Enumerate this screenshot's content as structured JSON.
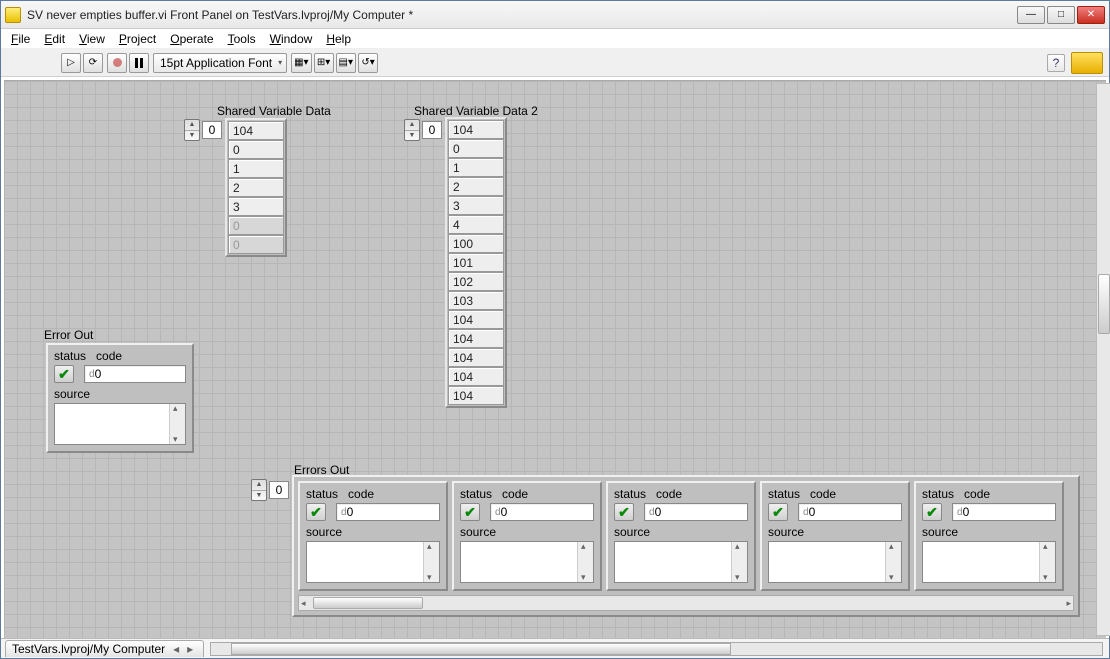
{
  "window": {
    "title": "SV never empties buffer.vi Front Panel on TestVars.lvproj/My Computer *"
  },
  "menu": {
    "file": "File",
    "edit": "Edit",
    "view": "View",
    "project": "Project",
    "operate": "Operate",
    "tools": "Tools",
    "window": "Window",
    "help": "Help"
  },
  "toolbar": {
    "font": "15pt Application Font"
  },
  "labels": {
    "svd1": "Shared Variable Data",
    "svd2": "Shared Variable Data 2",
    "errorOut": "Error Out",
    "errorsOut": "Errors Out",
    "status": "status",
    "code": "code",
    "source": "source"
  },
  "spin": {
    "svd1": "0",
    "svd2": "0",
    "errArr": "0"
  },
  "array1": [
    "104",
    "0",
    "1",
    "2",
    "3"
  ],
  "array1_inactive": [
    "0",
    "0"
  ],
  "array2": [
    "104",
    "0",
    "1",
    "2",
    "3",
    "4",
    "100",
    "101",
    "102",
    "103",
    "104",
    "104",
    "104",
    "104",
    "104"
  ],
  "errorOut": {
    "code": "0"
  },
  "errorsOut": [
    {
      "code": "0"
    },
    {
      "code": "0"
    },
    {
      "code": "0"
    },
    {
      "code": "0"
    },
    {
      "code": "0"
    }
  ],
  "statusbar": {
    "projectPath": "TestVars.lvproj/My Computer"
  }
}
